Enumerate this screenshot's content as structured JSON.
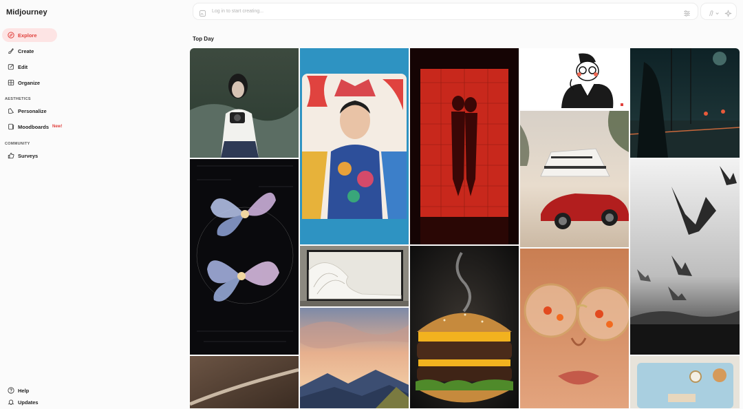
{
  "app": {
    "title": "Midjourney"
  },
  "sidebar": {
    "nav": [
      {
        "label": "Explore",
        "icon": "compass-icon"
      },
      {
        "label": "Create",
        "icon": "brush-icon"
      },
      {
        "label": "Edit",
        "icon": "edit-icon"
      },
      {
        "label": "Organize",
        "icon": "grid-icon"
      }
    ],
    "aesthetics_label": "AESTHETICS",
    "aesthetics": [
      {
        "label": "Personalize",
        "icon": "palette-icon"
      },
      {
        "label": "Moodboards",
        "icon": "moodboard-icon",
        "badge": "New!"
      }
    ],
    "community_label": "COMMUNITY",
    "community": [
      {
        "label": "Surveys",
        "icon": "thumbs-up-icon"
      }
    ],
    "footer": [
      {
        "label": "Help",
        "icon": "help-icon"
      },
      {
        "label": "Updates",
        "icon": "bell-icon"
      }
    ]
  },
  "prompt": {
    "placeholder": "Log in to start creating..."
  },
  "feed": {
    "title": "Top Day"
  },
  "colors": {
    "accent": "#e0413d",
    "active_bg": "#fde4e4"
  }
}
